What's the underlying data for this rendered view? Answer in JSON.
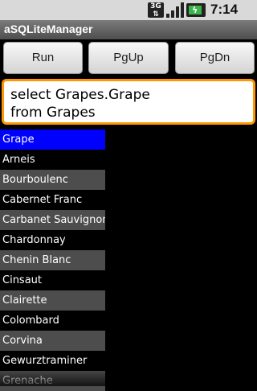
{
  "status_bar": {
    "network_label": "3G",
    "time": "7:14 PM",
    "icons": [
      "network-3g-icon",
      "signal-bars-icon",
      "battery-charging-icon"
    ],
    "battery_color": "#39b54a"
  },
  "app": {
    "title": "aSQLiteManager"
  },
  "toolbar": {
    "run_label": "Run",
    "pgup_label": "PgUp",
    "pgdn_label": "PgDn"
  },
  "query": {
    "text": "select Grapes.Grape\nfrom Grapes"
  },
  "results": {
    "column": "Grape",
    "rows": [
      "Arneis",
      "Bourboulenc",
      "Cabernet Franc",
      "Carbanet Sauvignon",
      "Chardonnay",
      "Chenin Blanc",
      "Cinsaut",
      "Clairette",
      "Colombard",
      "Corvina",
      "Gewurztraminer",
      "Grenache"
    ]
  },
  "colors": {
    "accent": "#ff9500",
    "header_highlight": "#0000ff"
  }
}
